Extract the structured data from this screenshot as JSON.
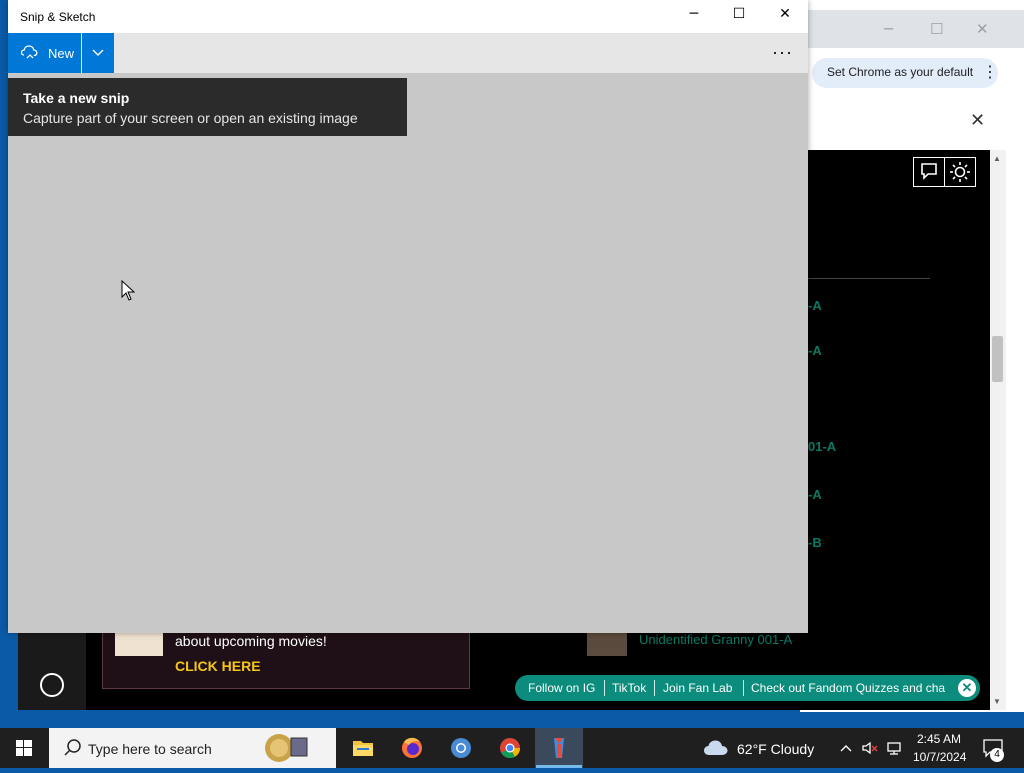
{
  "snip": {
    "title": "Snip & Sketch",
    "new_label": "New",
    "more_label": "···",
    "tooltip_title": "Take a new snip",
    "tooltip_body": "Capture part of your screen or open an existing image",
    "minimize_glyph": "─",
    "maximize_glyph": "☐",
    "close_glyph": "✕"
  },
  "chrome": {
    "minimize_glyph": "─",
    "maximize_glyph": "☐",
    "close_glyph": "✕",
    "default_prompt": "Set Chrome as your default",
    "menu_glyph": "⋮",
    "infobar_close": "✕"
  },
  "page": {
    "links": [
      "-A",
      "-A",
      "01-A",
      "-A",
      "-B"
    ],
    "ad_text": "about upcoming movies!",
    "ad_cta": "CLICK HERE",
    "granny_text": "Unidentified Granny 001-A",
    "follow_bar": {
      "items": [
        "Follow on IG",
        "TikTok",
        "Join Fan Lab",
        "Check out Fandom Quizzes and cha"
      ],
      "close": "✕"
    }
  },
  "taskbar": {
    "search_placeholder": "Type here to search",
    "weather": "62°F  Cloudy",
    "time": "2:45 AM",
    "date": "10/7/2024",
    "notification_count": "4",
    "apps": [
      "file-explorer",
      "firefox",
      "chromium",
      "chrome",
      "app-active"
    ]
  },
  "colors": {
    "accent": "#0078d7",
    "fandom_teal": "#0c8c7c",
    "cta_yellow": "#f5c518"
  }
}
